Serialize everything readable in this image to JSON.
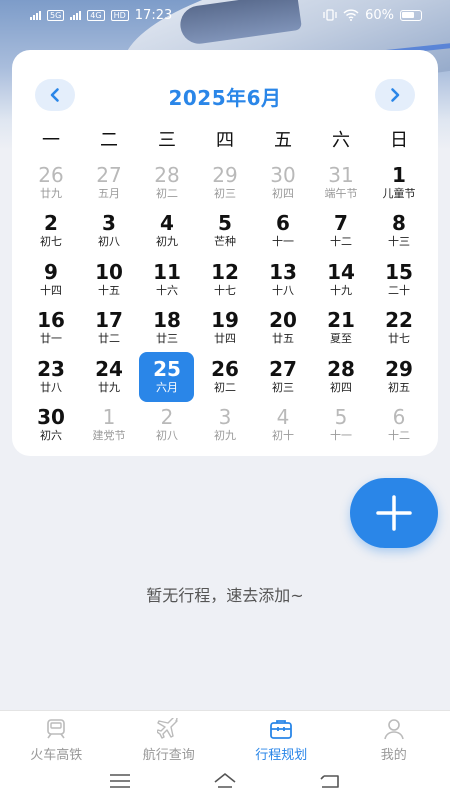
{
  "status_bar": {
    "network_left": "5G",
    "network_right": "4G",
    "hd": "HD",
    "time": "17:23",
    "battery_percent": "60%"
  },
  "calendar": {
    "title": "2025年6月",
    "weekdays": [
      "一",
      "二",
      "三",
      "四",
      "五",
      "六",
      "日"
    ],
    "days": [
      {
        "num": "26",
        "sub": "廿九",
        "other": true
      },
      {
        "num": "27",
        "sub": "五月",
        "other": true
      },
      {
        "num": "28",
        "sub": "初二",
        "other": true
      },
      {
        "num": "29",
        "sub": "初三",
        "other": true
      },
      {
        "num": "30",
        "sub": "初四",
        "other": true
      },
      {
        "num": "31",
        "sub": "端午节",
        "other": true
      },
      {
        "num": "1",
        "sub": "儿童节",
        "other": false
      },
      {
        "num": "2",
        "sub": "初七",
        "other": false
      },
      {
        "num": "3",
        "sub": "初八",
        "other": false
      },
      {
        "num": "4",
        "sub": "初九",
        "other": false
      },
      {
        "num": "5",
        "sub": "芒种",
        "other": false
      },
      {
        "num": "6",
        "sub": "十一",
        "other": false
      },
      {
        "num": "7",
        "sub": "十二",
        "other": false
      },
      {
        "num": "8",
        "sub": "十三",
        "other": false
      },
      {
        "num": "9",
        "sub": "十四",
        "other": false
      },
      {
        "num": "10",
        "sub": "十五",
        "other": false
      },
      {
        "num": "11",
        "sub": "十六",
        "other": false
      },
      {
        "num": "12",
        "sub": "十七",
        "other": false
      },
      {
        "num": "13",
        "sub": "十八",
        "other": false
      },
      {
        "num": "14",
        "sub": "十九",
        "other": false
      },
      {
        "num": "15",
        "sub": "二十",
        "other": false
      },
      {
        "num": "16",
        "sub": "廿一",
        "other": false
      },
      {
        "num": "17",
        "sub": "廿二",
        "other": false
      },
      {
        "num": "18",
        "sub": "廿三",
        "other": false
      },
      {
        "num": "19",
        "sub": "廿四",
        "other": false
      },
      {
        "num": "20",
        "sub": "廿五",
        "other": false
      },
      {
        "num": "21",
        "sub": "夏至",
        "other": false
      },
      {
        "num": "22",
        "sub": "廿七",
        "other": false
      },
      {
        "num": "23",
        "sub": "廿八",
        "other": false
      },
      {
        "num": "24",
        "sub": "廿九",
        "other": false
      },
      {
        "num": "25",
        "sub": "六月",
        "other": false,
        "selected": true
      },
      {
        "num": "26",
        "sub": "初二",
        "other": false
      },
      {
        "num": "27",
        "sub": "初三",
        "other": false
      },
      {
        "num": "28",
        "sub": "初四",
        "other": false
      },
      {
        "num": "29",
        "sub": "初五",
        "other": false
      },
      {
        "num": "30",
        "sub": "初六",
        "other": false
      },
      {
        "num": "1",
        "sub": "建党节",
        "other": true
      },
      {
        "num": "2",
        "sub": "初八",
        "other": true
      },
      {
        "num": "3",
        "sub": "初九",
        "other": true
      },
      {
        "num": "4",
        "sub": "初十",
        "other": true
      },
      {
        "num": "5",
        "sub": "十一",
        "other": true
      },
      {
        "num": "6",
        "sub": "十二",
        "other": true
      }
    ]
  },
  "empty_state": "暂无行程，速去添加~",
  "tabs": [
    {
      "label": "火车高铁",
      "icon": "train-icon",
      "active": false
    },
    {
      "label": "航行查询",
      "icon": "plane-icon",
      "active": false
    },
    {
      "label": "行程规划",
      "icon": "suitcase-icon",
      "active": true
    },
    {
      "label": "我的",
      "icon": "person-icon",
      "active": false
    }
  ],
  "colors": {
    "accent": "#2a86e8",
    "inactive": "#999999",
    "background": "#eef0f5"
  },
  "icons": {
    "prev": "chevron-left-icon",
    "next": "chevron-right-icon",
    "add": "plus-icon",
    "sys_menu": "menu-icon",
    "sys_home": "home-icon",
    "sys_back": "back-icon"
  }
}
